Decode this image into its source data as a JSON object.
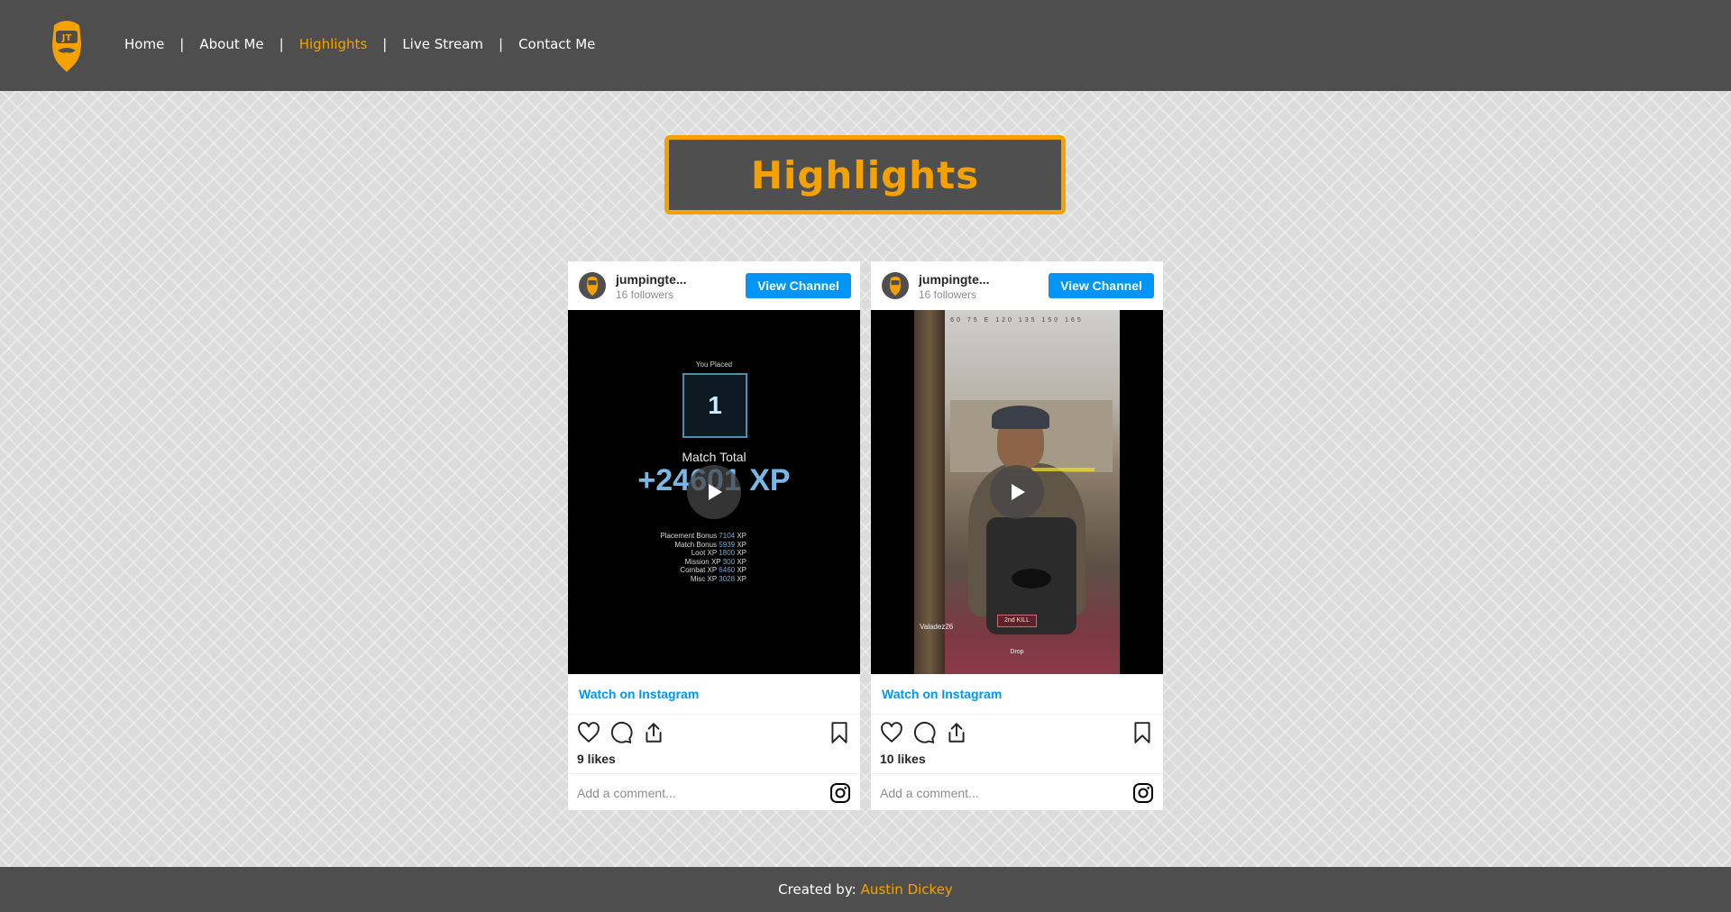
{
  "nav": {
    "items": [
      {
        "label": "Home",
        "active": false
      },
      {
        "label": "About Me",
        "active": false
      },
      {
        "label": "Highlights",
        "active": true
      },
      {
        "label": "Live Stream",
        "active": false
      },
      {
        "label": "Contact Me",
        "active": false
      }
    ],
    "separator": "|",
    "logo_text": "JT"
  },
  "page": {
    "title": "Highlights"
  },
  "posts": [
    {
      "username": "jumpingte...",
      "followers": "16 followers",
      "view_channel": "View Channel",
      "watch_link": "Watch on Instagram",
      "likes": "9 likes",
      "comment_placeholder": "Add a comment...",
      "media": {
        "you_placed": "You Placed",
        "place": "1",
        "match_total_label": "Match Total",
        "match_total": "+24601 XP",
        "breakdown": [
          {
            "label": "Placement Bonus",
            "value": "7104",
            "unit": "XP"
          },
          {
            "label": "Match Bonus",
            "value": "5939",
            "unit": "XP"
          },
          {
            "label": "Loot XP",
            "value": "1800",
            "unit": "XP"
          },
          {
            "label": "Mission XP",
            "value": "300",
            "unit": "XP"
          },
          {
            "label": "Combat XP",
            "value": "6460",
            "unit": "XP"
          },
          {
            "label": "Misc XP",
            "value": "3028",
            "unit": "XP"
          }
        ]
      }
    },
    {
      "username": "jumpingte...",
      "followers": "16 followers",
      "view_channel": "View Channel",
      "watch_link": "Watch on Instagram",
      "likes": "10 likes",
      "comment_placeholder": "Add a comment...",
      "media": {
        "compass": "60 75 E 120 135 150 165",
        "compass_heading": "E",
        "kill_label": "2nd KILL",
        "player_name": "Valadez26",
        "drop_label": "Drop"
      }
    }
  ],
  "footer": {
    "created_by_label": "Created by:",
    "author": "Austin Dickey"
  },
  "colors": {
    "accent": "#f5a200",
    "nav_bg": "#4e4e4e",
    "instagram_blue": "#0095f6"
  }
}
